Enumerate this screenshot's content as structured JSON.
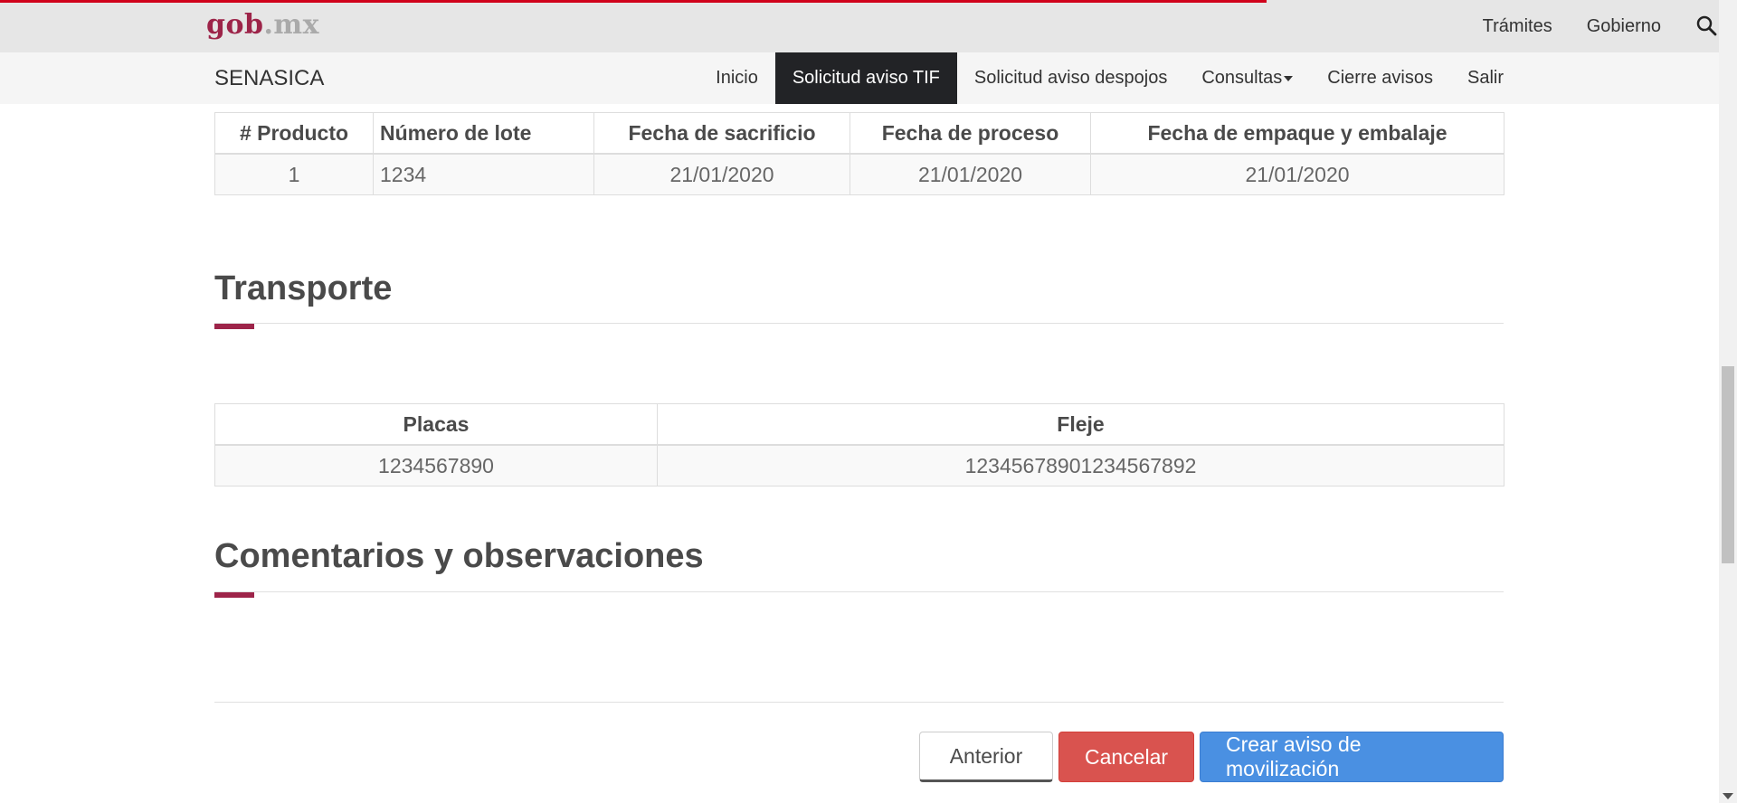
{
  "header": {
    "logo_part1": "gob",
    "logo_part2": ".mx",
    "links": [
      "Trámites",
      "Gobierno"
    ]
  },
  "nav": {
    "brand": "SENASICA",
    "items": [
      "Inicio",
      "Solicitud aviso TIF",
      "Solicitud aviso despojos",
      "Consultas",
      "Cierre avisos",
      "Salir"
    ],
    "active_item": "Solicitud aviso TIF"
  },
  "product_table": {
    "headers": [
      "# Producto",
      "Número de lote",
      "Fecha de sacrificio",
      "Fecha de proceso",
      "Fecha de empaque y embalaje"
    ],
    "rows": [
      [
        "1",
        "1234",
        "21/01/2020",
        "21/01/2020",
        "21/01/2020"
      ]
    ]
  },
  "transporte": {
    "title": "Transporte",
    "headers": [
      "Placas",
      "Fleje"
    ],
    "rows": [
      [
        "1234567890",
        "12345678901234567892"
      ]
    ]
  },
  "comentarios": {
    "title": "Comentarios y observaciones"
  },
  "actions": {
    "previous": "Anterior",
    "cancel": "Cancelar",
    "create": "Crear aviso de movilización"
  },
  "colors": {
    "brand": "#9d2449",
    "nav_active": "#222326",
    "danger": "#d9534f",
    "primary": "#4a90e2",
    "progress": "#d0021b"
  }
}
